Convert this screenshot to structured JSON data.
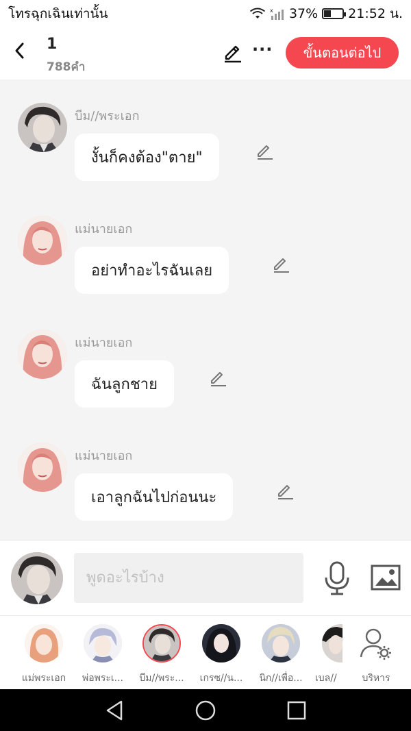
{
  "status_bar": {
    "carrier": "โทรฉุกเฉินเท่านั้น",
    "battery_text": "37%",
    "battery_level": 0.37,
    "time": "21:52 น."
  },
  "header": {
    "title": "1",
    "word_count": "788คำ",
    "next_label": "ขั้นตอนต่อไป",
    "more_label": "···",
    "back_label": "‹",
    "accent": "#f5474f"
  },
  "messages": [
    {
      "name": "บีม//พระเอก",
      "text": "งั้นก็คงต้อง\"ตาย\"",
      "avatar": "dark-hair-man"
    },
    {
      "name": "แม่นายเอก",
      "text": "อย่าทำอะไรฉันเลย",
      "avatar": "pink-hair-woman"
    },
    {
      "name": "แม่นายเอก",
      "text": "ฉันลูกชาย",
      "avatar": "pink-hair-woman"
    },
    {
      "name": "แม่นายเอก",
      "text": "เอาลูกฉันไปก่อนนะ",
      "avatar": "pink-hair-woman"
    }
  ],
  "composer": {
    "placeholder": "พูดอะไรบ้าง"
  },
  "characters": [
    {
      "name": "แม่พระเอก",
      "selected": false
    },
    {
      "name": "พ่อพระเ...",
      "selected": false
    },
    {
      "name": "บีม//พระ...",
      "selected": true
    },
    {
      "name": "เกรซ//น...",
      "selected": false
    },
    {
      "name": "นิก//เพื่อ...",
      "selected": false
    },
    {
      "name": "เบล//",
      "selected": false
    }
  ],
  "manage_label": "บริหาร"
}
